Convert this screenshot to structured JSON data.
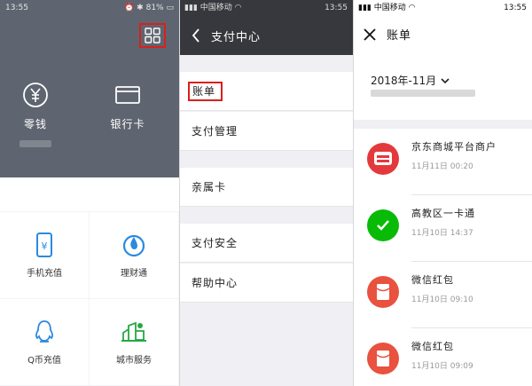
{
  "panel1": {
    "status": {
      "time": "13:55",
      "battery": "81%"
    },
    "wallet": [
      {
        "label": "零钱",
        "icon": "yen-circle-icon"
      },
      {
        "label": "银行卡",
        "icon": "bank-card-icon"
      }
    ],
    "services": [
      {
        "label": "手机充值",
        "icon": "phone-recharge-icon"
      },
      {
        "label": "理财通",
        "icon": "wealth-drop-icon"
      },
      {
        "label": "Q币充值",
        "icon": "qq-penguin-icon"
      },
      {
        "label": "城市服务",
        "icon": "city-service-icon"
      }
    ],
    "accent": "#d9201c"
  },
  "panel2": {
    "status": {
      "carrier": "中国移动",
      "time": "13:55"
    },
    "title": "支付中心",
    "menu": [
      {
        "label": "账单"
      },
      {
        "label": "支付管理"
      },
      {
        "label": "亲属卡"
      },
      {
        "label": "支付安全"
      },
      {
        "label": "帮助中心"
      }
    ]
  },
  "panel3": {
    "status": {
      "carrier": "中国移动",
      "time": "13:55"
    },
    "title": "账单",
    "month": "2018年-11月",
    "bills": [
      {
        "name": "京东商城平台商户",
        "time": "11月11日 00:20",
        "icon": "jd-logo-icon",
        "color": "#e4393c"
      },
      {
        "name": "高教区一卡通",
        "time": "11月10日 14:37",
        "icon": "wechat-pay-icon",
        "color": "#09bb07"
      },
      {
        "name": "微信红包",
        "time": "11月10日 09:10",
        "icon": "red-packet-icon",
        "color": "#e8523f"
      },
      {
        "name": "微信红包",
        "time": "11月10日 09:09",
        "icon": "red-packet-icon",
        "color": "#e8523f"
      }
    ]
  }
}
